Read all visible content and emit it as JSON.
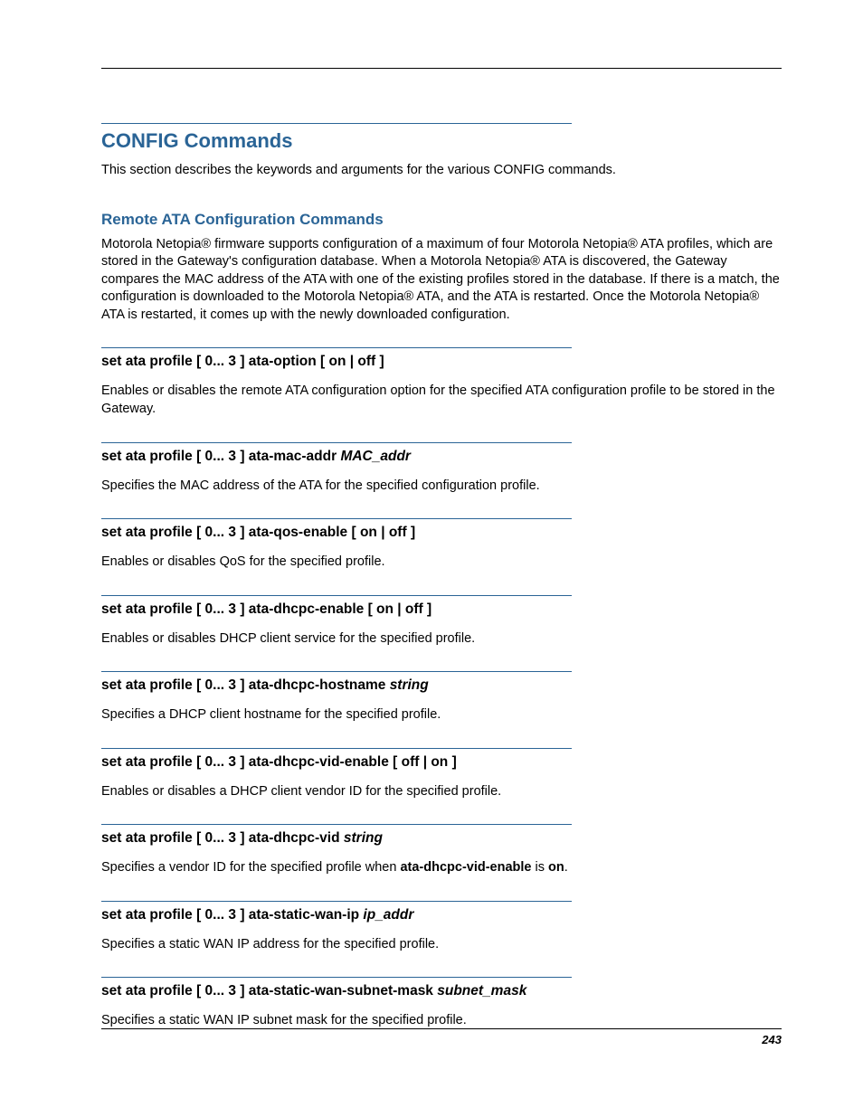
{
  "title": "CONFIG Commands",
  "intro": "This section describes the keywords and arguments for the various CONFIG commands.",
  "subsection_title": "Remote ATA Configuration Commands",
  "subsection_body": "Motorola Netopia® firmware supports configuration of a maximum of four Motorola Netopia® ATA profiles, which are stored in the Gateway's configuration database. When a Motorola Netopia® ATA is discovered, the Gateway compares the MAC address of the ATA with one of the existing profiles stored in the database. If there is a match, the configuration is downloaded to the Motorola Netopia® ATA, and the ATA is restarted. Once the Motorola Netopia® ATA is restarted, it comes up with the newly downloaded configuration.",
  "commands": [
    {
      "head": "set ata profile [  0... 3 ] ata-option [ on | off ]",
      "arg": "",
      "desc_pre": "Enables or disables the remote ATA configuration option for the specified ATA configuration profile to be stored in the Gateway.",
      "kw1": "",
      "mid": "",
      "kw2": "",
      "post": ""
    },
    {
      "head": "set ata profile [  0... 3 ] ata-mac-addr ",
      "arg": "MAC_addr",
      "desc_pre": "Specifies the MAC address of the ATA for the specified configuration profile.",
      "kw1": "",
      "mid": "",
      "kw2": "",
      "post": ""
    },
    {
      "head": "set ata profile [  0... 3 ] ata-qos-enable [ on | off ]",
      "arg": "",
      "desc_pre": "Enables or disables QoS for the specified profile.",
      "kw1": "",
      "mid": "",
      "kw2": "",
      "post": ""
    },
    {
      "head": "set ata profile [  0... 3 ] ata-dhcpc-enable [ on | off ]",
      "arg": "",
      "desc_pre": "Enables or disables DHCP client service for the specified profile.",
      "kw1": "",
      "mid": "",
      "kw2": "",
      "post": ""
    },
    {
      "head": "set ata profile [  0... 3 ] ata-dhcpc-hostname ",
      "arg": "string",
      "desc_pre": "Specifies a DHCP client hostname for the specified profile.",
      "kw1": "",
      "mid": "",
      "kw2": "",
      "post": ""
    },
    {
      "head": "set ata profile [  0... 3 ] ata-dhcpc-vid-enable [ off | on ]",
      "arg": "",
      "desc_pre": "Enables or disables a DHCP client vendor ID for the specified profile.",
      "kw1": "",
      "mid": "",
      "kw2": "",
      "post": ""
    },
    {
      "head": "set ata profile [  0... 3 ] ata-dhcpc-vid ",
      "arg": "string",
      "desc_pre": "Specifies a vendor ID for the specified profile when ",
      "kw1": "ata-dhcpc-vid-enable",
      "mid": " is ",
      "kw2": "on",
      "post": "."
    },
    {
      "head": "set ata profile [  0... 3 ] ata-static-wan-ip ",
      "arg": "ip_addr",
      "desc_pre": "Specifies a static WAN IP address for the specified profile.",
      "kw1": "",
      "mid": "",
      "kw2": "",
      "post": ""
    },
    {
      "head": "set ata profile [  0... 3 ] ata-static-wan-subnet-mask ",
      "arg": "subnet_mask",
      "desc_pre": "Specifies a static WAN IP subnet mask for the specified profile.",
      "kw1": "",
      "mid": "",
      "kw2": "",
      "post": ""
    }
  ],
  "page_number": "243"
}
